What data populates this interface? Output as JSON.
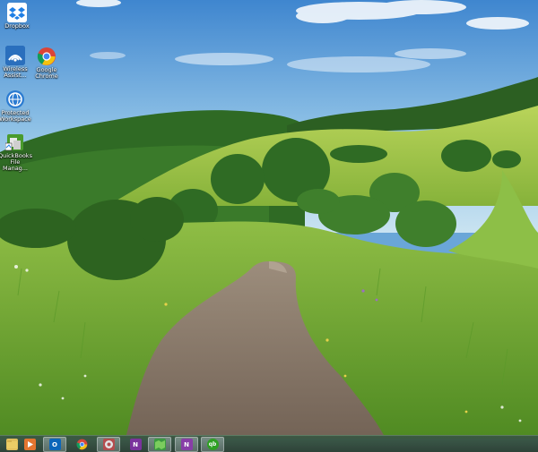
{
  "desktop_icons": [
    {
      "label": "Dropbox",
      "icon": "dropbox-icon"
    },
    {
      "label": "Wireless Assist...",
      "icon": "wireless-icon"
    },
    {
      "label": "Google Chrome",
      "icon": "chrome-icon"
    },
    {
      "label": "Protected Workspace",
      "icon": "protected-workspace-icon"
    },
    {
      "label": "QuickBooks File Manag...",
      "icon": "quickbooks-file-manager-icon"
    }
  ],
  "taskbar": {
    "items": [
      {
        "icon": "file-explorer-icon",
        "active": false
      },
      {
        "icon": "media-player-icon",
        "active": false
      },
      {
        "icon": "outlook-icon",
        "glyph": "O",
        "active": true
      },
      {
        "icon": "chrome-icon",
        "active": false
      },
      {
        "icon": "photo-app-icon",
        "active": true
      },
      {
        "icon": "onenote-icon",
        "glyph": "N",
        "active": false
      },
      {
        "icon": "maps-icon",
        "active": true
      },
      {
        "icon": "onenote-notes-icon",
        "glyph": "N",
        "active": true
      },
      {
        "icon": "quickbooks-icon",
        "glyph": "qb",
        "active": true
      }
    ]
  },
  "colors": {
    "sky": "#6aa6d8",
    "grass": "#7fb43a",
    "path": "#8a7b6e",
    "taskbar": "#2f4436"
  }
}
